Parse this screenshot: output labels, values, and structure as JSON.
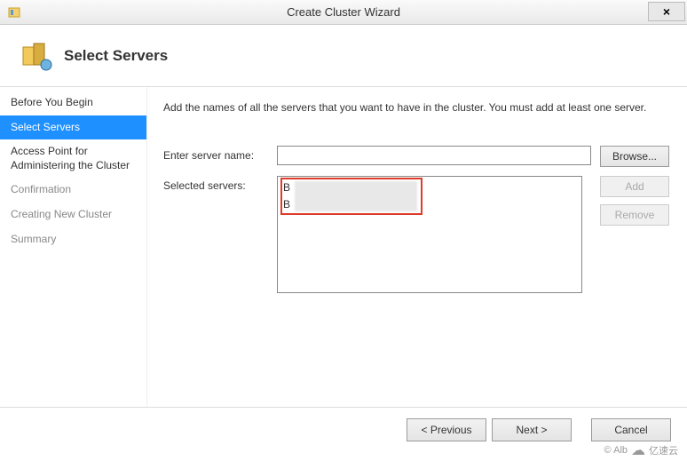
{
  "window": {
    "title": "Create Cluster Wizard",
    "close_label": "×"
  },
  "header": {
    "page_title": "Select Servers"
  },
  "sidebar": {
    "steps": [
      {
        "label": "Before You Begin",
        "state": "done"
      },
      {
        "label": "Select Servers",
        "state": "active"
      },
      {
        "label": "Access Point for Administering the Cluster",
        "state": "done"
      },
      {
        "label": "Confirmation",
        "state": "pending"
      },
      {
        "label": "Creating New Cluster",
        "state": "pending"
      },
      {
        "label": "Summary",
        "state": "pending"
      }
    ]
  },
  "main": {
    "intro": "Add the names of all the servers that you want to have in the cluster. You must add at least one server.",
    "enter_label": "Enter server name:",
    "enter_value": "",
    "selected_label": "Selected servers:",
    "selected_items": [
      "B",
      "B"
    ],
    "browse_label": "Browse...",
    "add_label": "Add",
    "remove_label": "Remove"
  },
  "footer": {
    "previous": "< Previous",
    "next": "Next >",
    "cancel": "Cancel"
  },
  "watermark": {
    "author": "© Alb",
    "brand": "亿速云"
  }
}
